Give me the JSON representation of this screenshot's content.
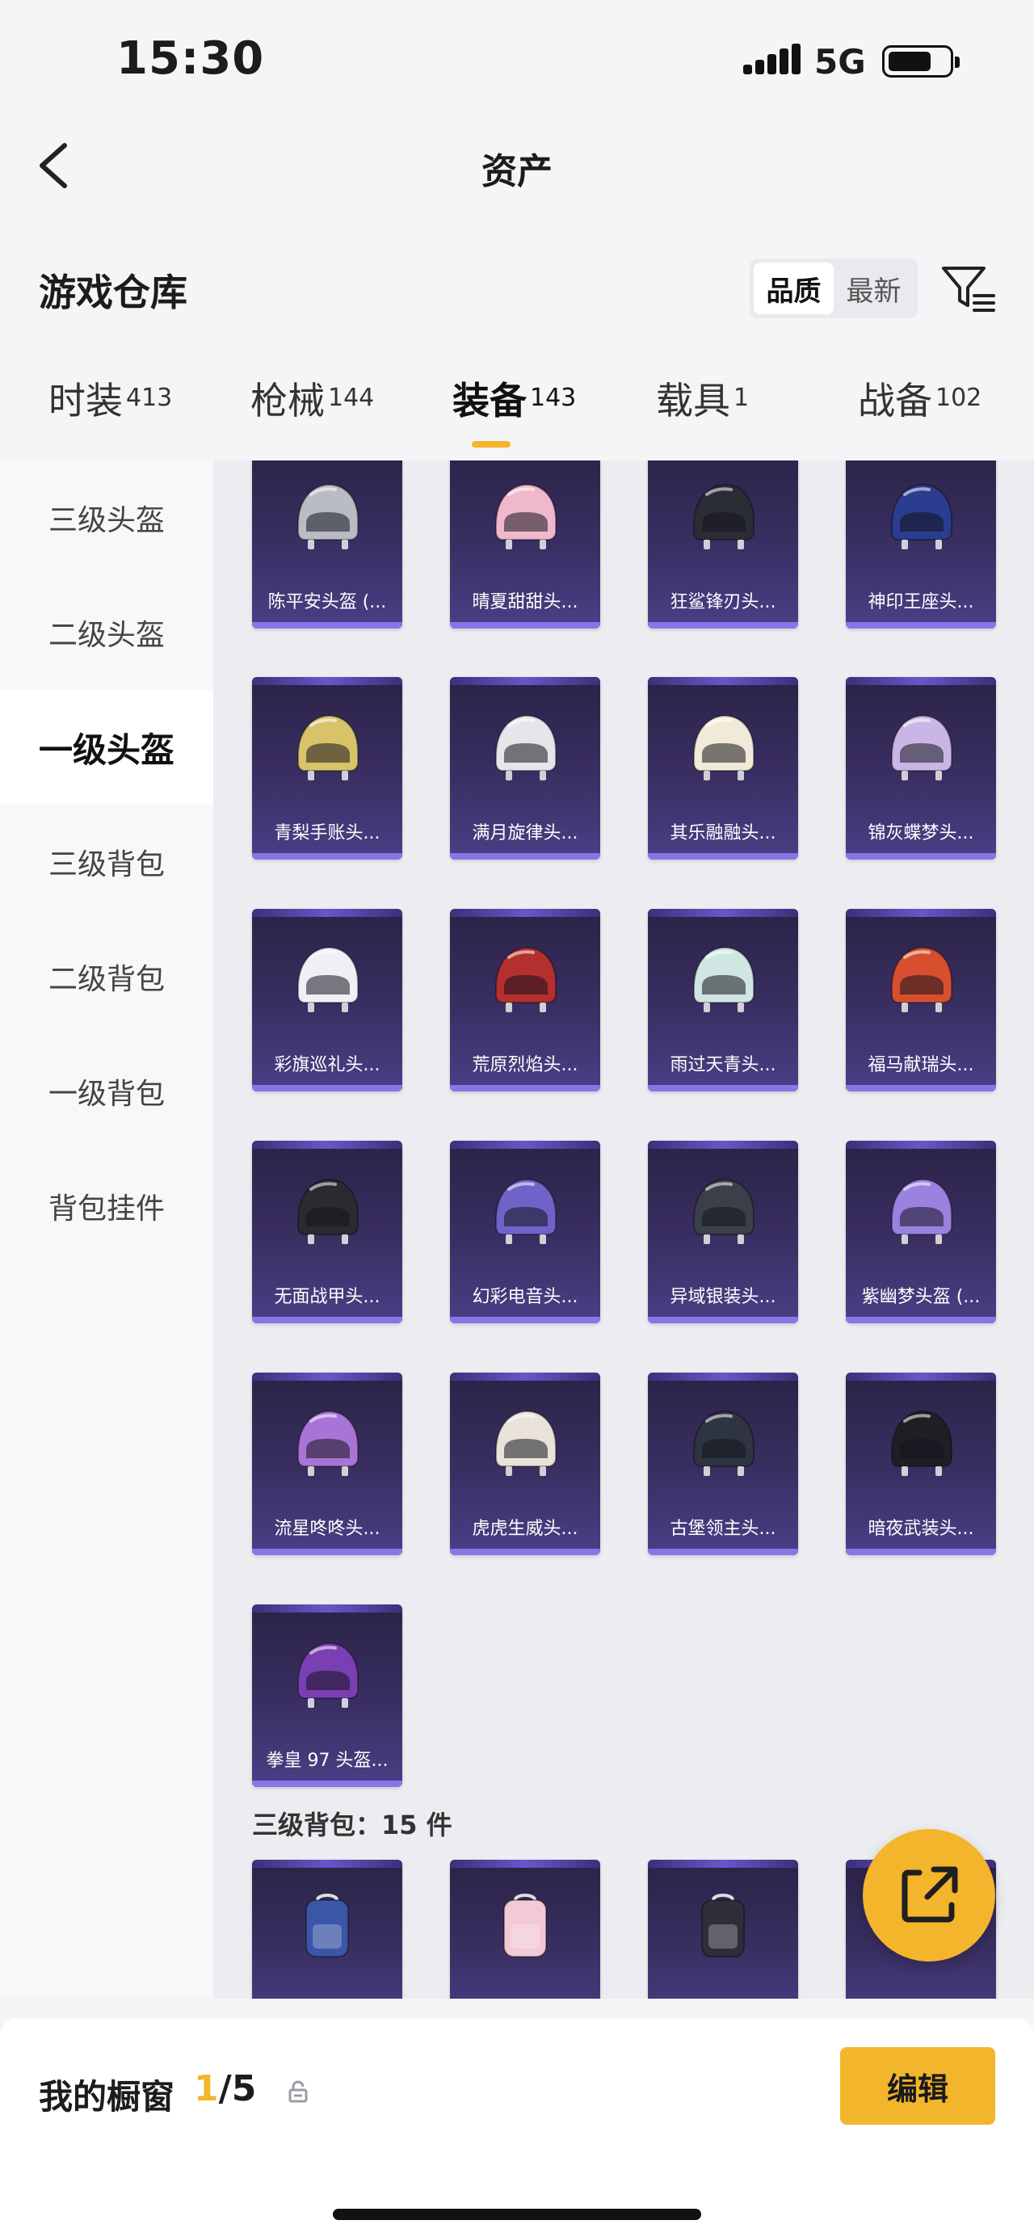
{
  "status_bar": {
    "time": "15:30",
    "network": "5G"
  },
  "header": {
    "title": "资产"
  },
  "section": {
    "title": "游戏仓库",
    "sort_options": [
      "品质",
      "最新"
    ]
  },
  "tabs": [
    {
      "label": "时装",
      "count": "413"
    },
    {
      "label": "枪械",
      "count": "144"
    },
    {
      "label": "装备",
      "count": "143"
    },
    {
      "label": "载具",
      "count": "1"
    },
    {
      "label": "战备",
      "count": "102"
    }
  ],
  "sidebar": {
    "items": [
      "三级头盔",
      "二级头盔",
      "一级头盔",
      "三级背包",
      "二级背包",
      "一级背包",
      "背包挂件"
    ]
  },
  "helmets": [
    {
      "name": "陈平安头盔 (...",
      "color": "#b9bcc4"
    },
    {
      "name": "晴夏甜甜头...",
      "color": "#f0b8cc"
    },
    {
      "name": "狂鲨锋刃头...",
      "color": "#2a2d36"
    },
    {
      "name": "神印王座头...",
      "color": "#2a3d8f"
    },
    {
      "name": "青梨手账头...",
      "color": "#d9c36a"
    },
    {
      "name": "满月旋律头...",
      "color": "#e4e6ea"
    },
    {
      "name": "其乐融融头...",
      "color": "#f2ead8"
    },
    {
      "name": "锦灰蝶梦头...",
      "color": "#c9b6e6"
    },
    {
      "name": "彩旗巡礼头...",
      "color": "#eef0f5"
    },
    {
      "name": "荒原烈焰头...",
      "color": "#b3302e"
    },
    {
      "name": "雨过天青头...",
      "color": "#cfe6e2"
    },
    {
      "name": "福马献瑞头...",
      "color": "#d84f2f"
    },
    {
      "name": "无面战甲头...",
      "color": "#2b2b2f"
    },
    {
      "name": "幻彩电音头...",
      "color": "#6f63c8"
    },
    {
      "name": "异域银装头...",
      "color": "#3a3f4a"
    },
    {
      "name": "紫幽梦头盔 (...",
      "color": "#9b82e0"
    },
    {
      "name": "流星咚咚头...",
      "color": "#a874d6"
    },
    {
      "name": "虎虎生威头...",
      "color": "#e8e2d8"
    },
    {
      "name": "古堡领主头...",
      "color": "#2f3442"
    },
    {
      "name": "暗夜武装头...",
      "color": "#1e1f25"
    },
    {
      "name": "拳皇 97 头盔...",
      "color": "#7a3fb3"
    }
  ],
  "backpack_group": {
    "label": "三级背包：15 件"
  },
  "backpacks": [
    {
      "color": "#3b56a6"
    },
    {
      "color": "#f2c9d4"
    },
    {
      "color": "#2e2e3a"
    },
    {
      "color": "#b24a3a"
    }
  ],
  "bottom": {
    "showcase_label": "我的橱窗",
    "current": "1",
    "total": "/5",
    "edit_label": "编辑"
  },
  "colors": {
    "accent": "#f3b52c"
  }
}
